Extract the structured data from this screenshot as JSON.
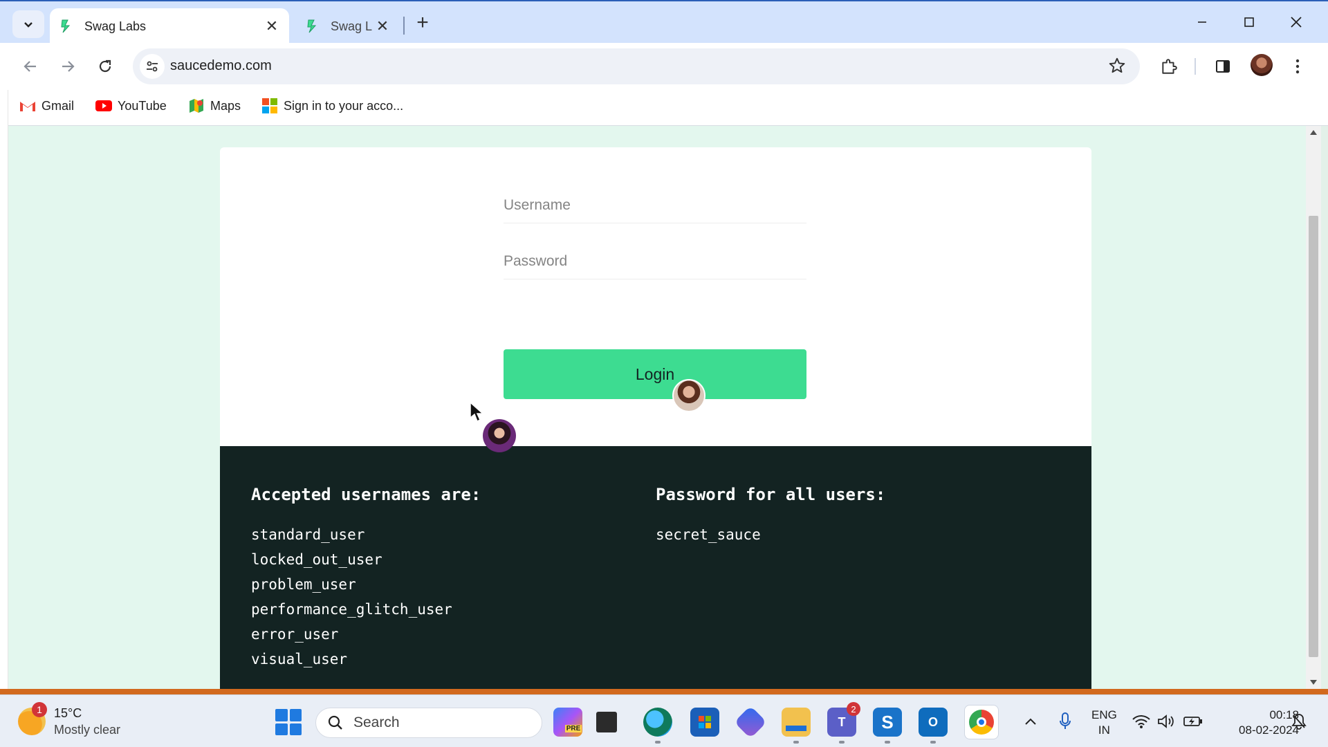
{
  "browser": {
    "tabs": [
      {
        "title": "Swag Labs",
        "active": true
      },
      {
        "title": "Swag L",
        "active": false
      }
    ],
    "url": "saucedemo.com",
    "bookmarks": [
      {
        "label": "Gmail",
        "icon": "gmail-icon"
      },
      {
        "label": "YouTube",
        "icon": "youtube-icon"
      },
      {
        "label": "Maps",
        "icon": "maps-icon"
      },
      {
        "label": "Sign in to your acco...",
        "icon": "microsoft-icon"
      }
    ]
  },
  "login": {
    "username_placeholder": "Username",
    "password_placeholder": "Password",
    "login_button": "Login"
  },
  "credentials": {
    "usernames_heading": "Accepted usernames are:",
    "usernames": [
      "standard_user",
      "locked_out_user",
      "problem_user",
      "performance_glitch_user",
      "error_user",
      "visual_user"
    ],
    "password_heading": "Password for all users:",
    "password": "secret_sauce"
  },
  "taskbar": {
    "weather_temp": "15°C",
    "weather_desc": "Mostly clear",
    "weather_badge": "1",
    "search_label": "Search",
    "teams_badge": "2",
    "lang_primary": "ENG",
    "lang_secondary": "IN",
    "time": "00:18",
    "date": "08-02-2024"
  },
  "colors": {
    "accent_green": "#3ddc91",
    "dark_panel": "#132322",
    "page_bg": "#e3f7ee",
    "tabbar_bg": "#d3e3fd"
  }
}
